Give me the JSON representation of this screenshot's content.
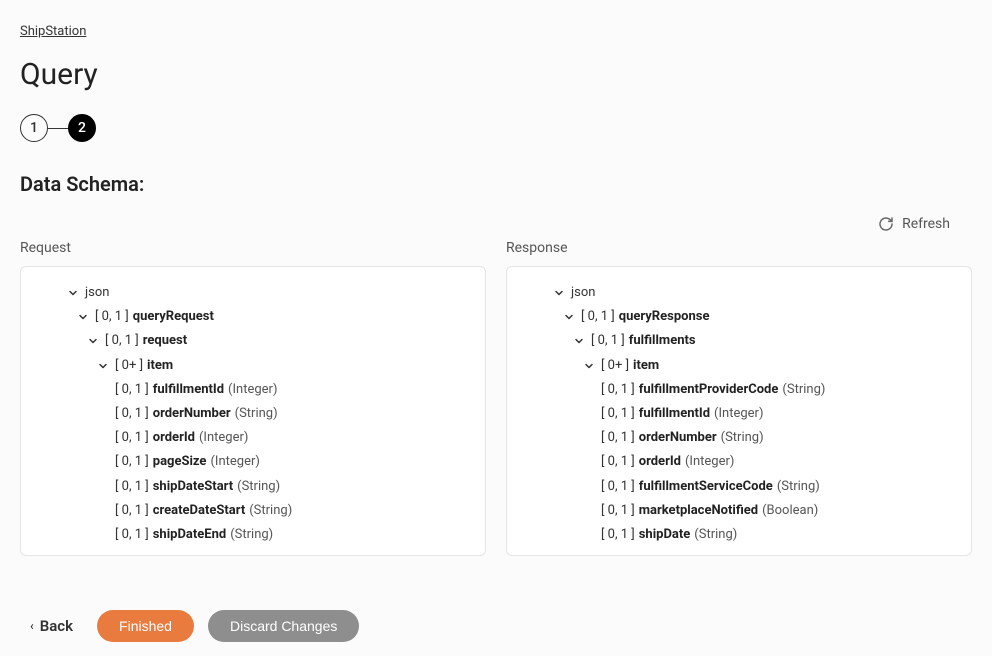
{
  "breadcrumb": "ShipStation",
  "page_title": "Query",
  "stepper": {
    "steps": [
      "1",
      "2"
    ],
    "active_index": 1
  },
  "section_title": "Data Schema:",
  "refresh_label": "Refresh",
  "request": {
    "header": "Request",
    "root": "json",
    "tree": [
      {
        "level": 1,
        "chevron": true,
        "cardinality": "[ 0, 1 ]",
        "name": "queryRequest",
        "type": ""
      },
      {
        "level": 2,
        "chevron": true,
        "cardinality": "[ 0, 1 ]",
        "name": "request",
        "type": ""
      },
      {
        "level": 3,
        "chevron": true,
        "cardinality": "[ 0+ ]",
        "name": "item",
        "type": ""
      },
      {
        "level": 4,
        "chevron": false,
        "cardinality": "[ 0, 1 ]",
        "name": "fulfillmentId",
        "type": "(Integer)"
      },
      {
        "level": 4,
        "chevron": false,
        "cardinality": "[ 0, 1 ]",
        "name": "orderNumber",
        "type": "(String)"
      },
      {
        "level": 4,
        "chevron": false,
        "cardinality": "[ 0, 1 ]",
        "name": "orderId",
        "type": "(Integer)"
      },
      {
        "level": 4,
        "chevron": false,
        "cardinality": "[ 0, 1 ]",
        "name": "pageSize",
        "type": "(Integer)"
      },
      {
        "level": 4,
        "chevron": false,
        "cardinality": "[ 0, 1 ]",
        "name": "shipDateStart",
        "type": "(String)"
      },
      {
        "level": 4,
        "chevron": false,
        "cardinality": "[ 0, 1 ]",
        "name": "createDateStart",
        "type": "(String)"
      },
      {
        "level": 4,
        "chevron": false,
        "cardinality": "[ 0, 1 ]",
        "name": "shipDateEnd",
        "type": "(String)"
      }
    ]
  },
  "response": {
    "header": "Response",
    "root": "json",
    "tree": [
      {
        "level": 1,
        "chevron": true,
        "cardinality": "[ 0, 1 ]",
        "name": "queryResponse",
        "type": ""
      },
      {
        "level": 2,
        "chevron": true,
        "cardinality": "[ 0, 1 ]",
        "name": "fulfillments",
        "type": ""
      },
      {
        "level": 3,
        "chevron": true,
        "cardinality": "[ 0+ ]",
        "name": "item",
        "type": ""
      },
      {
        "level": 4,
        "chevron": false,
        "cardinality": "[ 0, 1 ]",
        "name": "fulfillmentProviderCode",
        "type": "(String)"
      },
      {
        "level": 4,
        "chevron": false,
        "cardinality": "[ 0, 1 ]",
        "name": "fulfillmentId",
        "type": "(Integer)"
      },
      {
        "level": 4,
        "chevron": false,
        "cardinality": "[ 0, 1 ]",
        "name": "orderNumber",
        "type": "(String)"
      },
      {
        "level": 4,
        "chevron": false,
        "cardinality": "[ 0, 1 ]",
        "name": "orderId",
        "type": "(Integer)"
      },
      {
        "level": 4,
        "chevron": false,
        "cardinality": "[ 0, 1 ]",
        "name": "fulfillmentServiceCode",
        "type": "(String)"
      },
      {
        "level": 4,
        "chevron": false,
        "cardinality": "[ 0, 1 ]",
        "name": "marketplaceNotified",
        "type": "(Boolean)"
      },
      {
        "level": 4,
        "chevron": false,
        "cardinality": "[ 0, 1 ]",
        "name": "shipDate",
        "type": "(String)"
      }
    ]
  },
  "footer": {
    "back": "Back",
    "finished": "Finished",
    "discard": "Discard Changes"
  }
}
